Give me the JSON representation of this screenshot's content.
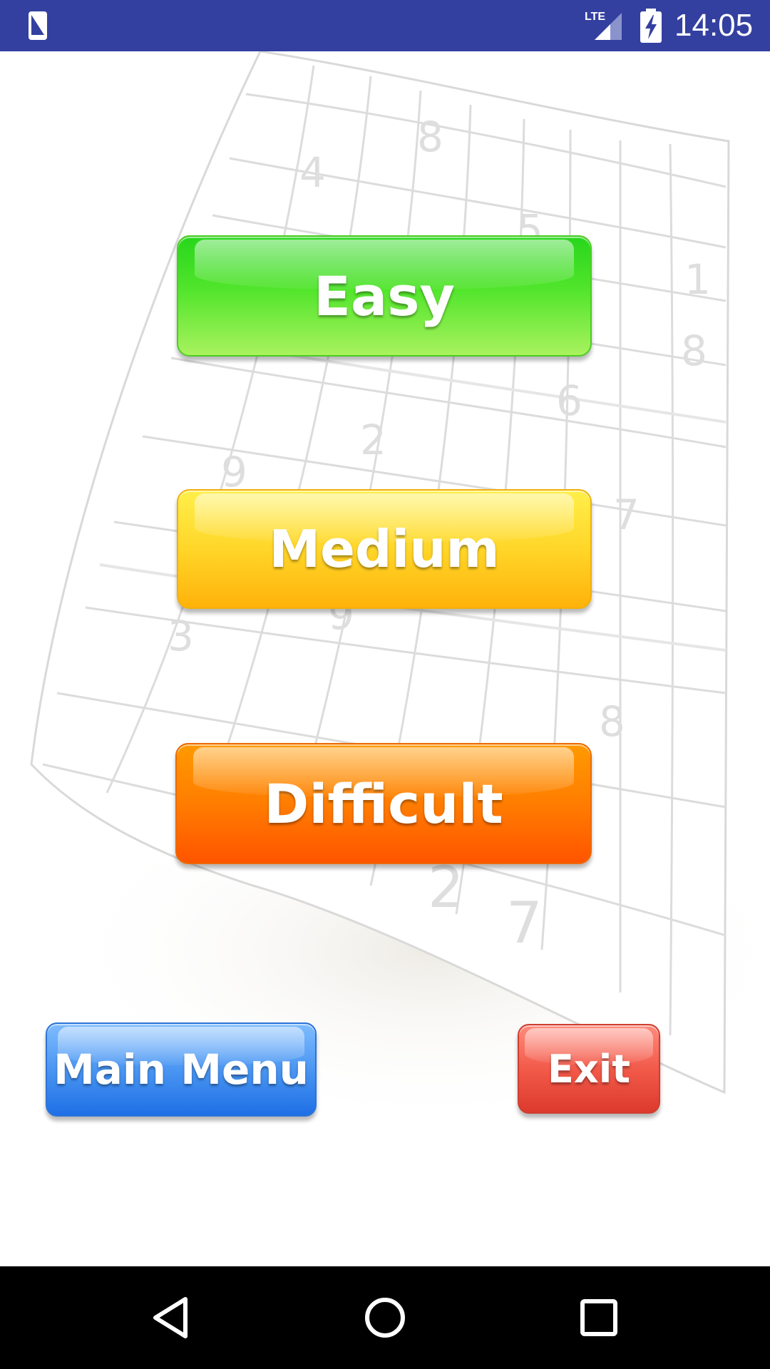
{
  "status_bar": {
    "time": "14:05",
    "network_label": "LTE",
    "background_color": "#3340a0",
    "icons": [
      "notification-phone-icon",
      "lte-signal-icon",
      "battery-charging-icon"
    ]
  },
  "background": {
    "puzzle_digits": [
      "8",
      "4",
      "5",
      "1",
      "8",
      "6",
      "2",
      "9",
      "7",
      "9",
      "3",
      "8",
      "2",
      "7"
    ]
  },
  "difficulty": {
    "easy_label": "Easy",
    "medium_label": "Medium",
    "difficult_label": "Difficult"
  },
  "footer": {
    "main_menu_label": "Main Menu",
    "exit_label": "Exit"
  },
  "colors": {
    "easy": "#39d922",
    "medium": "#ffd02a",
    "difficult": "#ff6d00",
    "main_menu": "#3c8bf0",
    "exit": "#ec5040"
  },
  "nav_bar": {
    "icons": [
      "back-icon",
      "home-icon",
      "recents-icon"
    ]
  }
}
